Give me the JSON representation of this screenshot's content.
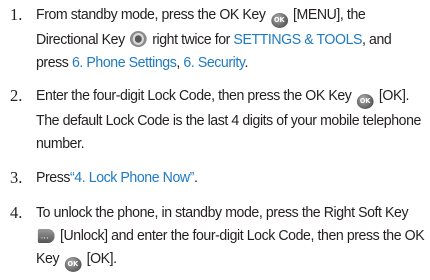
{
  "steps": [
    {
      "number": "1.",
      "parts": {
        "a": "From standby mode, press the OK Key",
        "ok_icon": "OK",
        "b": "[MENU], the Directional Key",
        "c": "right twice for",
        "link1": "SETTINGS & TOOLS",
        "d": ", and press",
        "link2": "6. Phone Settings",
        "e": ",",
        "link3": "6. Security",
        "f": "."
      }
    },
    {
      "number": "2.",
      "parts": {
        "a": "Enter the four-digit Lock Code, then press the OK Key",
        "ok_icon": "OK",
        "b": "[OK]. The default Lock Code is the last 4 digits of your mobile telephone number."
      }
    },
    {
      "number": "3.",
      "parts": {
        "a": "Press",
        "link1": "“4. Lock Phone Now”",
        "b": "."
      }
    },
    {
      "number": "4.",
      "parts": {
        "a": "To unlock the phone, in standby mode, press the Right Soft Key",
        "b": "[Unlock] and enter the four-digit Lock Code, then press the OK Key",
        "ok_icon": "OK",
        "c": "[OK]."
      }
    }
  ],
  "colors": {
    "text": "#231f20",
    "link": "#1e7ac2"
  },
  "icons": [
    "ok-key-icon",
    "directional-key-icon",
    "right-soft-key-icon"
  ]
}
